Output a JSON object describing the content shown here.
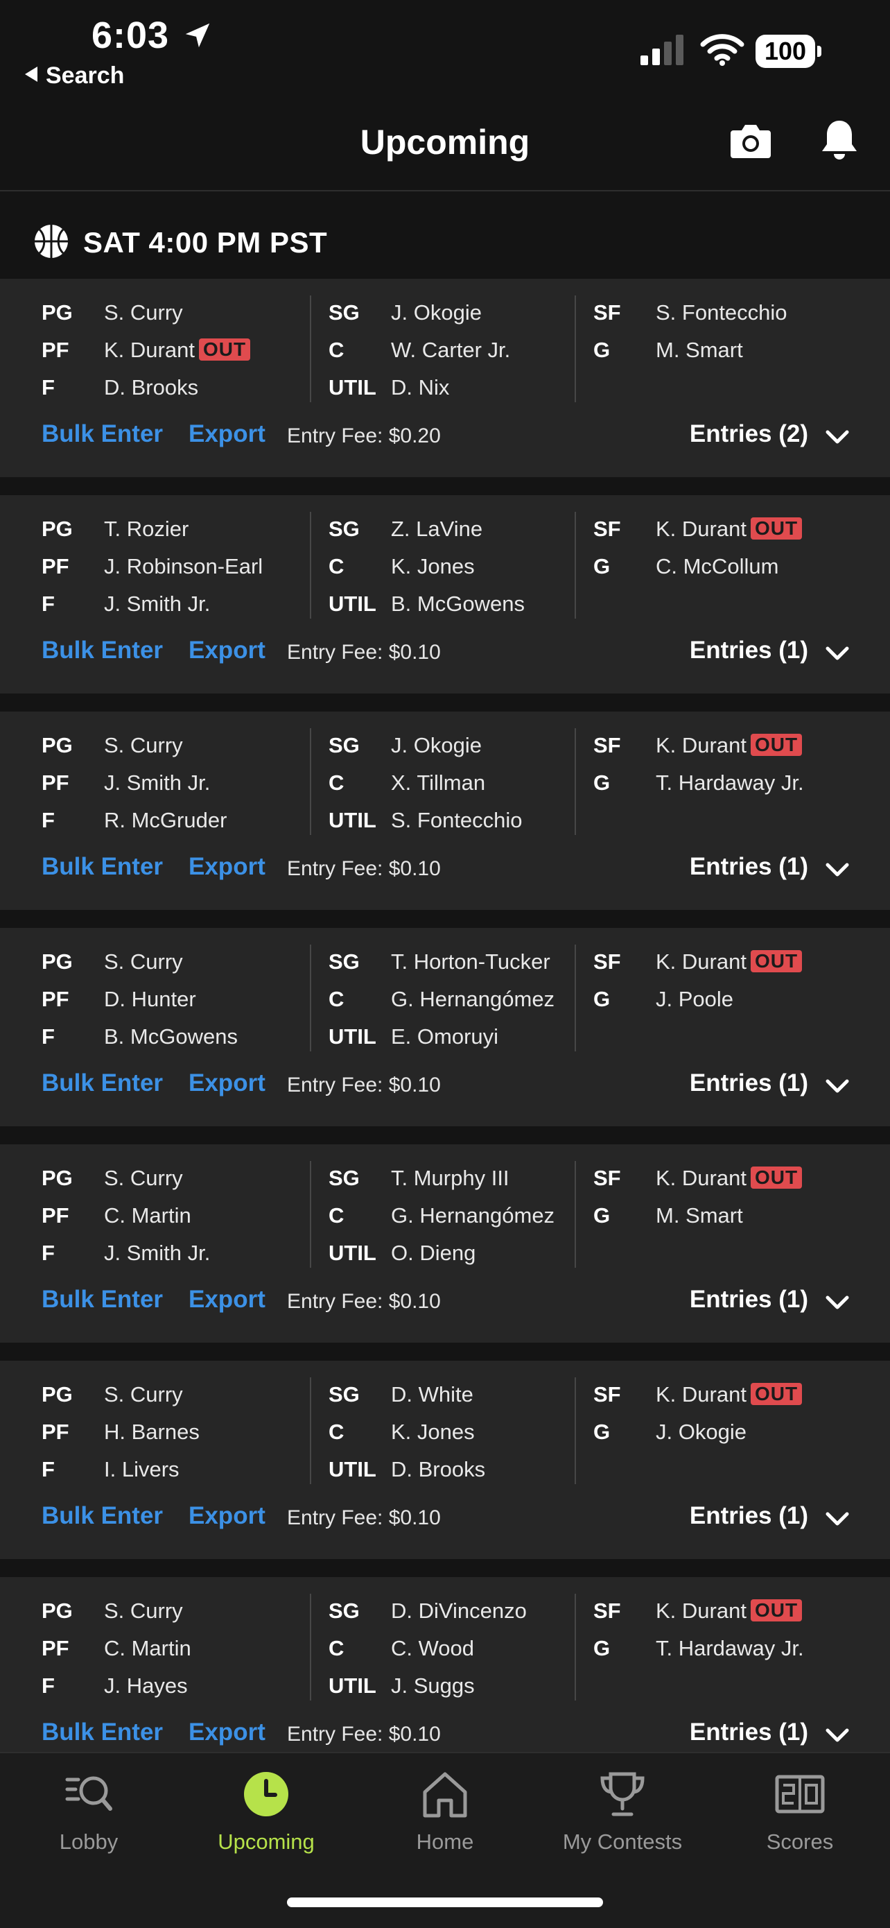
{
  "status_bar": {
    "time": "6:03",
    "back_label": "Search",
    "battery": "100"
  },
  "header": {
    "title": "Upcoming"
  },
  "section": {
    "title": "SAT 4:00 PM PST"
  },
  "labels": {
    "bulk_enter": "Bulk Enter",
    "export": "Export",
    "out_badge": "OUT"
  },
  "lineups": [
    {
      "fee": "Entry Fee: $0.20",
      "entries": "Entries (2)",
      "c1": [
        {
          "pos": "PG",
          "name": "S. Curry",
          "out": false
        },
        {
          "pos": "PF",
          "name": "K. Durant",
          "out": true
        },
        {
          "pos": "F",
          "name": "D. Brooks",
          "out": false
        }
      ],
      "c2": [
        {
          "pos": "SG",
          "name": "J. Okogie",
          "out": false
        },
        {
          "pos": "C",
          "name": "W. Carter Jr.",
          "out": false
        },
        {
          "pos": "UTIL",
          "name": "D. Nix",
          "out": false
        }
      ],
      "c3": [
        {
          "pos": "SF",
          "name": "S. Fontecchio",
          "out": false
        },
        {
          "pos": "G",
          "name": "M. Smart",
          "out": false
        }
      ]
    },
    {
      "fee": "Entry Fee: $0.10",
      "entries": "Entries (1)",
      "c1": [
        {
          "pos": "PG",
          "name": "T. Rozier",
          "out": false
        },
        {
          "pos": "PF",
          "name": "J. Robinson-Earl",
          "out": false
        },
        {
          "pos": "F",
          "name": "J. Smith Jr.",
          "out": false
        }
      ],
      "c2": [
        {
          "pos": "SG",
          "name": "Z. LaVine",
          "out": false
        },
        {
          "pos": "C",
          "name": "K. Jones",
          "out": false
        },
        {
          "pos": "UTIL",
          "name": "B. McGowens",
          "out": false
        }
      ],
      "c3": [
        {
          "pos": "SF",
          "name": "K. Durant",
          "out": true
        },
        {
          "pos": "G",
          "name": "C. McCollum",
          "out": false
        }
      ]
    },
    {
      "fee": "Entry Fee: $0.10",
      "entries": "Entries (1)",
      "c1": [
        {
          "pos": "PG",
          "name": "S. Curry",
          "out": false
        },
        {
          "pos": "PF",
          "name": "J. Smith Jr.",
          "out": false
        },
        {
          "pos": "F",
          "name": "R. McGruder",
          "out": false
        }
      ],
      "c2": [
        {
          "pos": "SG",
          "name": "J. Okogie",
          "out": false
        },
        {
          "pos": "C",
          "name": "X. Tillman",
          "out": false
        },
        {
          "pos": "UTIL",
          "name": "S. Fontecchio",
          "out": false
        }
      ],
      "c3": [
        {
          "pos": "SF",
          "name": "K. Durant",
          "out": true
        },
        {
          "pos": "G",
          "name": "T. Hardaway Jr.",
          "out": false
        }
      ]
    },
    {
      "fee": "Entry Fee: $0.10",
      "entries": "Entries (1)",
      "c1": [
        {
          "pos": "PG",
          "name": "S. Curry",
          "out": false
        },
        {
          "pos": "PF",
          "name": "D. Hunter",
          "out": false
        },
        {
          "pos": "F",
          "name": "B. McGowens",
          "out": false
        }
      ],
      "c2": [
        {
          "pos": "SG",
          "name": "T. Horton-Tucker",
          "out": false
        },
        {
          "pos": "C",
          "name": "G. Hernangómez",
          "out": false
        },
        {
          "pos": "UTIL",
          "name": "E. Omoruyi",
          "out": false
        }
      ],
      "c3": [
        {
          "pos": "SF",
          "name": "K. Durant",
          "out": true
        },
        {
          "pos": "G",
          "name": "J. Poole",
          "out": false
        }
      ]
    },
    {
      "fee": "Entry Fee: $0.10",
      "entries": "Entries (1)",
      "c1": [
        {
          "pos": "PG",
          "name": "S. Curry",
          "out": false
        },
        {
          "pos": "PF",
          "name": "C. Martin",
          "out": false
        },
        {
          "pos": "F",
          "name": "J. Smith Jr.",
          "out": false
        }
      ],
      "c2": [
        {
          "pos": "SG",
          "name": "T. Murphy III",
          "out": false
        },
        {
          "pos": "C",
          "name": "G. Hernangómez",
          "out": false
        },
        {
          "pos": "UTIL",
          "name": "O. Dieng",
          "out": false
        }
      ],
      "c3": [
        {
          "pos": "SF",
          "name": "K. Durant",
          "out": true
        },
        {
          "pos": "G",
          "name": "M. Smart",
          "out": false
        }
      ]
    },
    {
      "fee": "Entry Fee: $0.10",
      "entries": "Entries (1)",
      "c1": [
        {
          "pos": "PG",
          "name": "S. Curry",
          "out": false
        },
        {
          "pos": "PF",
          "name": "H. Barnes",
          "out": false
        },
        {
          "pos": "F",
          "name": "I. Livers",
          "out": false
        }
      ],
      "c2": [
        {
          "pos": "SG",
          "name": "D. White",
          "out": false
        },
        {
          "pos": "C",
          "name": "K. Jones",
          "out": false
        },
        {
          "pos": "UTIL",
          "name": "D. Brooks",
          "out": false
        }
      ],
      "c3": [
        {
          "pos": "SF",
          "name": "K. Durant",
          "out": true
        },
        {
          "pos": "G",
          "name": "J. Okogie",
          "out": false
        }
      ]
    },
    {
      "fee": "Entry Fee: $0.10",
      "entries": "Entries (1)",
      "c1": [
        {
          "pos": "PG",
          "name": "S. Curry",
          "out": false
        },
        {
          "pos": "PF",
          "name": "C. Martin",
          "out": false
        },
        {
          "pos": "F",
          "name": "J. Hayes",
          "out": false
        }
      ],
      "c2": [
        {
          "pos": "SG",
          "name": "D. DiVincenzo",
          "out": false
        },
        {
          "pos": "C",
          "name": "C. Wood",
          "out": false
        },
        {
          "pos": "UTIL",
          "name": "J. Suggs",
          "out": false
        }
      ],
      "c3": [
        {
          "pos": "SF",
          "name": "K. Durant",
          "out": true
        },
        {
          "pos": "G",
          "name": "T. Hardaway Jr.",
          "out": false
        }
      ]
    }
  ],
  "tabs": [
    {
      "label": "Lobby",
      "icon": "lobby-search-icon",
      "active": false
    },
    {
      "label": "Upcoming",
      "icon": "clock-icon",
      "active": true
    },
    {
      "label": "Home",
      "icon": "home-icon",
      "active": false
    },
    {
      "label": "My Contests",
      "icon": "trophy-icon",
      "active": false
    },
    {
      "label": "Scores",
      "icon": "scoreboard-icon",
      "active": false
    }
  ],
  "colors": {
    "accent_blue": "#3c91e6",
    "active_green": "#b6e24a",
    "out_red": "#e04b4e",
    "card_bg": "#262626",
    "page_bg": "#141414"
  }
}
